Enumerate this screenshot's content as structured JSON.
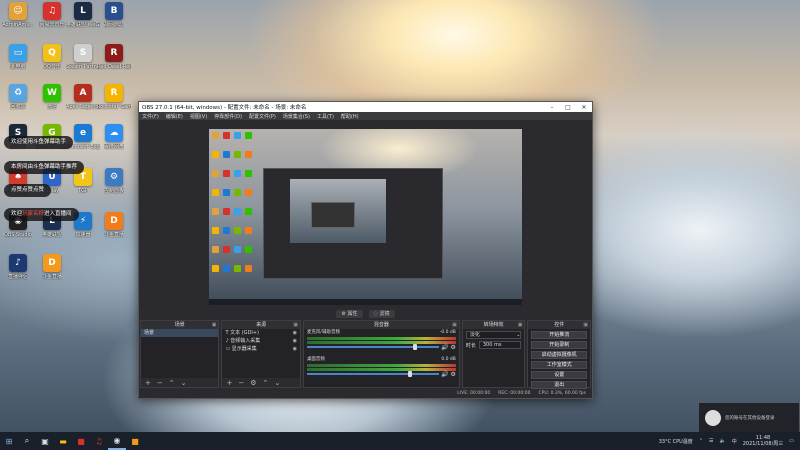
{
  "desktop_icons": [
    {
      "label": "AdminAms...",
      "color": "#e2a23a",
      "glyph": "☺",
      "icon": "user-folder-icon"
    },
    {
      "label": "网易云音乐",
      "color": "#d8302a",
      "glyph": "♫",
      "icon": "netease-music-icon"
    },
    {
      "label": "英雄联盟 WeGame版",
      "color": "#1b2b44",
      "glyph": "L",
      "icon": "lol-icon"
    },
    {
      "label": "战网启动",
      "color": "#2a4f8e",
      "glyph": "B",
      "icon": "battlenet-icon"
    },
    {
      "label": "此电脑",
      "color": "#3aa0e8",
      "glyph": "▭",
      "icon": "computer-icon"
    },
    {
      "label": "QQ音乐",
      "color": "#f2c21b",
      "glyph": "Q",
      "icon": "qqmusic-icon"
    },
    {
      "label": "Steam Partner",
      "color": "#cfcfcf",
      "glyph": "S",
      "icon": "steam-partner-icon"
    },
    {
      "label": "Red Dead Redemption 2",
      "color": "#8e1b1b",
      "glyph": "R",
      "icon": "rdr2-icon"
    },
    {
      "label": "回收站",
      "color": "#5aa5e0",
      "glyph": "♻",
      "icon": "recycle-bin-icon"
    },
    {
      "label": "微信",
      "color": "#2dc100",
      "glyph": "W",
      "icon": "wechat-icon"
    },
    {
      "label": "Apex Legends",
      "color": "#b52d1f",
      "glyph": "A",
      "icon": "apex-icon"
    },
    {
      "label": "Rockstar Games",
      "color": "#f5b400",
      "glyph": "R",
      "icon": "rockstar-icon"
    },
    {
      "label": "Steam",
      "color": "#1b2838",
      "glyph": "S",
      "icon": "steam-icon"
    },
    {
      "label": "GeForce Experience",
      "color": "#76b900",
      "glyph": "G",
      "icon": "geforce-icon"
    },
    {
      "label": "Microsoft Edge",
      "color": "#1d7ad1",
      "glyph": "e",
      "icon": "edge-icon"
    },
    {
      "label": "百度网盘",
      "color": "#2f8ef0",
      "glyph": "☁",
      "icon": "baidu-netdisk-icon"
    },
    {
      "label": "小丑直播",
      "color": "#d23c2c",
      "glyph": "♠",
      "icon": "live-icon"
    },
    {
      "label": "Uplay",
      "color": "#2d66c8",
      "glyph": "U",
      "icon": "uplay-icon"
    },
    {
      "label": "TGP",
      "color": "#f2c51a",
      "glyph": "T",
      "icon": "tgp-icon"
    },
    {
      "label": "控制面板",
      "color": "#3c7ac2",
      "glyph": "⚙",
      "icon": "control-panel-icon"
    },
    {
      "label": "OBS Studio",
      "color": "#202020",
      "glyph": "◉",
      "icon": "obs-icon"
    },
    {
      "label": "英雄联盟",
      "color": "#1b3050",
      "glyph": "L",
      "icon": "lol2-icon"
    },
    {
      "label": "加速器",
      "color": "#1f78c8",
      "glyph": "⚡",
      "icon": "accelerator-icon"
    },
    {
      "label": "斗鱼直播",
      "color": "#f07c1a",
      "glyph": "D",
      "icon": "douyu-icon"
    },
    {
      "label": "直播伴侣",
      "color": "#1c3a70",
      "glyph": "♪",
      "icon": "companion-icon"
    },
    {
      "label": "斗鱼直播",
      "color": "#f39a1d",
      "glyph": "D",
      "icon": "douyu2-icon"
    }
  ],
  "notifications": [
    {
      "text": "欢迎使用斗鱼弹幕助手"
    },
    {
      "text": "本房间由斗鱼弹幕助手推荐"
    },
    {
      "text": "点赞点赞点赞"
    },
    {
      "pre": "欢迎",
      "hl": "玩家名称",
      "post": "进入直播间"
    }
  ],
  "obs": {
    "title": "OBS 27.0.1 (64-bit, windows) - 配置文件: 未命名 - 场景: 未命名",
    "menu": [
      "文件(F)",
      "编辑(E)",
      "视图(V)",
      "停靠部件(D)",
      "配置文件(P)",
      "场景集合(S)",
      "工具(T)",
      "帮助(H)"
    ],
    "mid_tabs": [
      "⚙ 属性",
      "◌ 滤镜"
    ],
    "scenes": {
      "title": "场景",
      "items": [
        "场景"
      ]
    },
    "sources": {
      "title": "来源",
      "items": [
        "文本 (GDI+)",
        "音频输入采集",
        "显示器采集"
      ]
    },
    "mixer": {
      "title": "混音器",
      "tracks": [
        {
          "name": "麦克风/辅助音频",
          "db": "-0.0 dB",
          "level": 0.82
        },
        {
          "name": "桌面音频",
          "db": "0.0 dB",
          "level": 0.78
        }
      ]
    },
    "transitions": {
      "title": "转场特效",
      "type": "淡化",
      "duration_label": "时长",
      "duration": "300 ms"
    },
    "controls": {
      "title": "控件",
      "buttons": [
        "开始推流",
        "开始录制",
        "启动虚拟摄像机",
        "工作室模式",
        "设置",
        "退出"
      ]
    },
    "status": {
      "live": "LIVE: 00:00:00",
      "rec": "REC: 00:00:00",
      "cpu": "CPU: 0.3%, 60.00 fps"
    }
  },
  "taskbar": {
    "tray_labels": [
      "英",
      "中"
    ],
    "cpu_label": "33°C CPU温度",
    "time": "11:48",
    "date": "2021/11/08/周三"
  },
  "toast": {
    "text": "您的账号在其他设备登录"
  }
}
